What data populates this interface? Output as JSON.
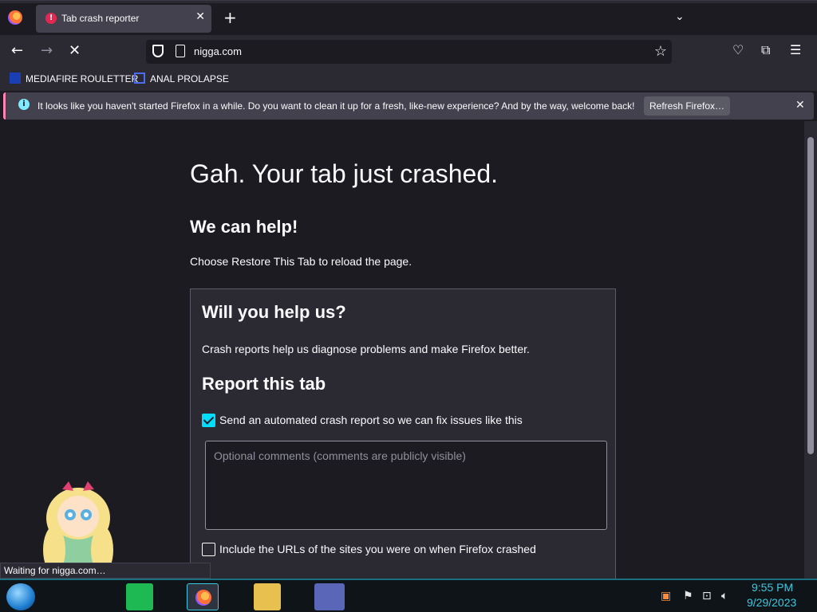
{
  "browser": {
    "tab": {
      "title": "Tab crash reporter"
    },
    "url": "nigga.com",
    "bookmarks": [
      {
        "label": "MEDIAFIRE ROULETTER"
      },
      {
        "label": "ANAL PROLAPSE"
      }
    ],
    "notification": {
      "text": "It looks like you haven't started Firefox in a while. Do you want to clean it up for a fresh, like-new experience? And by the way, welcome back!",
      "button": "Refresh Firefox…"
    },
    "status": "Waiting for nigga.com…"
  },
  "crash_page": {
    "title": "Gah. Your tab just crashed.",
    "help_heading": "We can help!",
    "help_text": "Choose Restore This Tab to reload the page.",
    "report": {
      "heading": "Will you help us?",
      "text": "Crash reports help us diagnose problems and make Firefox better.",
      "subheading": "Report this tab",
      "send_report_label": "Send an automated crash report so we can fix issues like this",
      "send_report_checked": true,
      "comments_placeholder": "Optional comments (comments are publicly visible)",
      "include_urls_label": "Include the URLs of the sites you were on when Firefox crashed",
      "include_urls_checked": false
    }
  },
  "taskbar": {
    "time": "9:55 PM",
    "date": "9/29/2023"
  },
  "colors": {
    "accent": "#00ddff",
    "page_bg": "#1c1b22",
    "toolbar_bg": "#2b2a33",
    "clock": "#3cc8e0"
  }
}
